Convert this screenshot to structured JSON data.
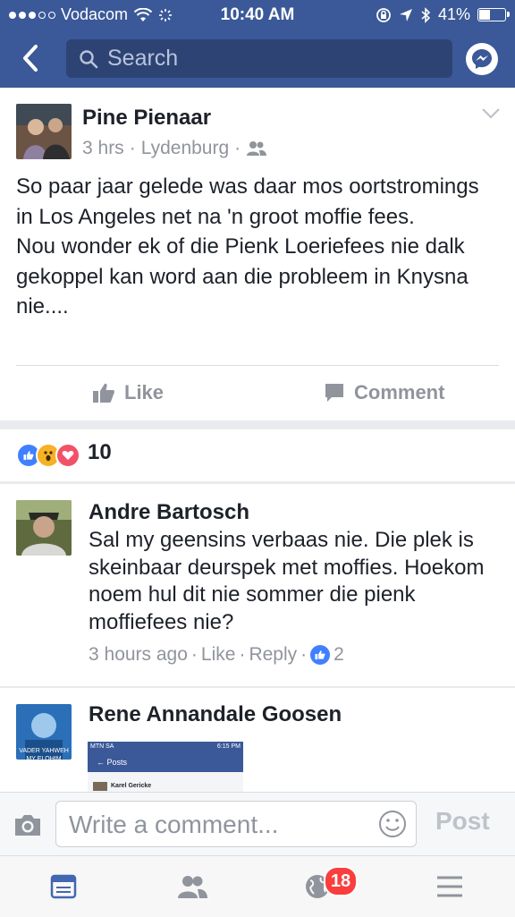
{
  "status_bar": {
    "carrier": "Vodacom",
    "time": "10:40 AM",
    "battery": "41%",
    "battery_level": 0.41
  },
  "nav": {
    "search_placeholder": "Search",
    "icons": [
      "back-icon",
      "search-icon",
      "messenger-icon"
    ]
  },
  "post": {
    "author": "Pine Pienaar",
    "time": "3 hrs",
    "location": "Lydenburg",
    "separator": "·",
    "text": "So paar jaar gelede was daar mos oortstromings in Los Angeles net na 'n groot moffie fees.\nNou wonder ek of die Pienk Loeriefees nie dalk gekoppel kan word aan die probleem in Knysna nie....",
    "actions": {
      "like": "Like",
      "comment": "Comment"
    }
  },
  "reactions": {
    "count": "10",
    "types": [
      "like",
      "wow",
      "love"
    ],
    "colors": {
      "like": "#4080ff",
      "wow": "#f7b125",
      "love": "#f25268"
    }
  },
  "comments": [
    {
      "author": "Andre Bartosch",
      "text": "Sal my geensins verbaas nie. Die plek is skeinbaar deurspek met moffies. Hoekom noem hul dit nie sommer die pienk moffiefees nie?",
      "time": "3 hours ago",
      "like": "Like",
      "reply": "Reply",
      "likes": "2"
    },
    {
      "author": "Rene Annandale Goosen",
      "avatar_caption": "Vader Yahweh My Elohim",
      "attachment": {
        "carrier": "MTN SA",
        "time": "6:15 PM",
        "title": "Posts",
        "author": "Karel Gericke"
      }
    }
  ],
  "composer": {
    "placeholder": "Write a comment...",
    "post_label": "Post"
  },
  "tabbar": {
    "notification_count": "18",
    "icons": [
      "news-feed-icon",
      "friends-icon",
      "globe-icon",
      "menu-icon"
    ]
  },
  "colors": {
    "brand": "#3b5998",
    "active_tab": "#4267b2",
    "badge": "#fa3e3e"
  }
}
